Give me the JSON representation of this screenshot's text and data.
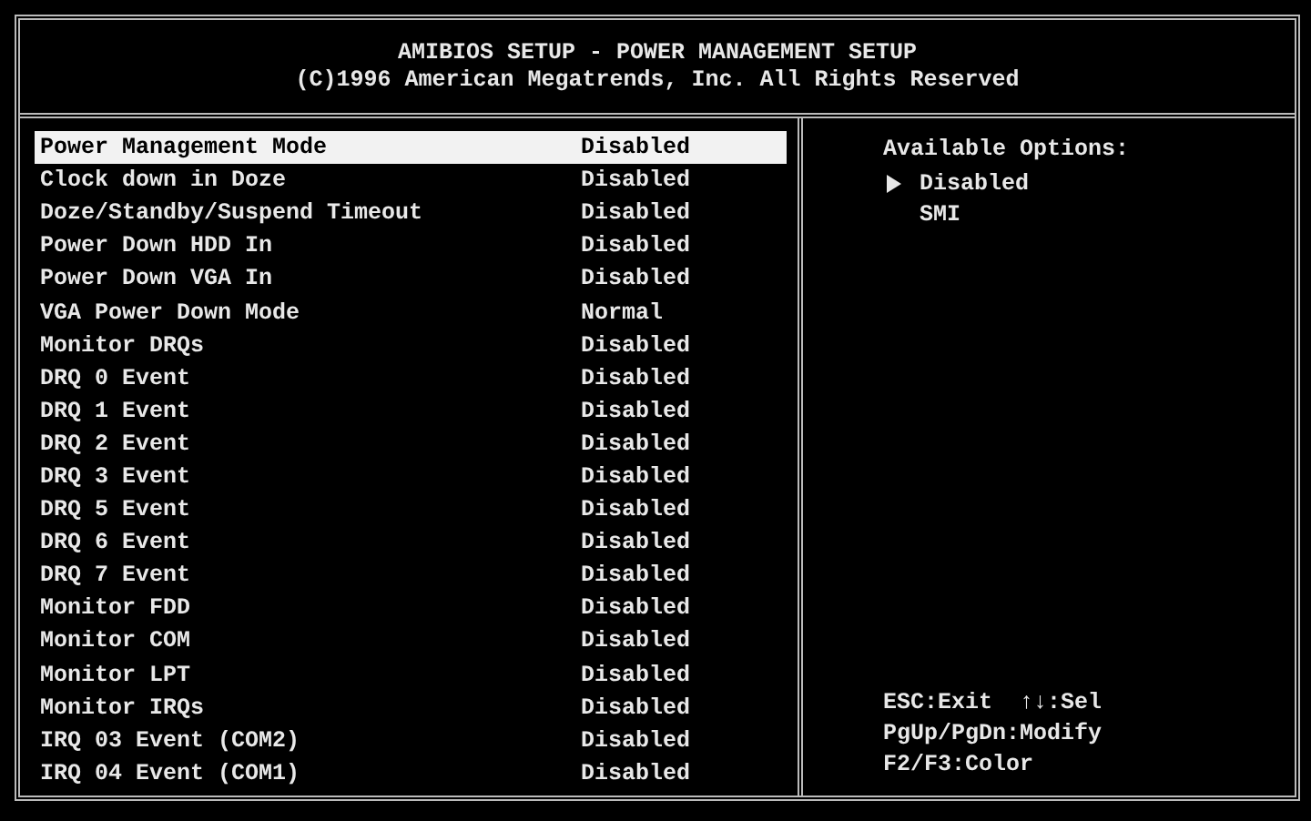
{
  "header": {
    "title": "AMIBIOS SETUP - POWER MANAGEMENT SETUP",
    "copyright": "(C)1996 American Megatrends, Inc. All Rights Reserved"
  },
  "settings": [
    {
      "label": "Power Management Mode",
      "value": "Disabled",
      "selected": true
    },
    {
      "label": "Clock down in Doze",
      "value": "Disabled",
      "selected": false
    },
    {
      "label": "Doze/Standby/Suspend Timeout",
      "value": "Disabled",
      "selected": false
    },
    {
      "label": "Power Down HDD In",
      "value": "Disabled",
      "selected": false
    },
    {
      "label": "Power Down VGA In",
      "value": "Disabled",
      "selected": false
    },
    {
      "label": "VGA Power Down Mode",
      "value": "Normal",
      "selected": false
    },
    {
      "label": "Monitor DRQs",
      "value": "Disabled",
      "selected": false
    },
    {
      "label": "DRQ 0 Event",
      "value": "Disabled",
      "selected": false
    },
    {
      "label": "DRQ 1 Event",
      "value": "Disabled",
      "selected": false
    },
    {
      "label": "DRQ 2 Event",
      "value": "Disabled",
      "selected": false
    },
    {
      "label": "DRQ 3 Event",
      "value": "Disabled",
      "selected": false
    },
    {
      "label": "DRQ 5 Event",
      "value": "Disabled",
      "selected": false
    },
    {
      "label": "DRQ 6 Event",
      "value": "Disabled",
      "selected": false
    },
    {
      "label": "DRQ 7 Event",
      "value": "Disabled",
      "selected": false
    },
    {
      "label": "Monitor FDD",
      "value": "Disabled",
      "selected": false
    },
    {
      "label": "Monitor COM",
      "value": "Disabled",
      "selected": false
    },
    {
      "label": "Monitor LPT",
      "value": "Disabled",
      "selected": false
    },
    {
      "label": "Monitor IRQs",
      "value": "Disabled",
      "selected": false
    },
    {
      "label": "IRQ 03 Event (COM2)",
      "value": "Disabled",
      "selected": false
    },
    {
      "label": "IRQ 04 Event (COM1)",
      "value": "Disabled",
      "selected": false
    }
  ],
  "options": {
    "title": "Available Options:",
    "items": [
      {
        "label": "Disabled",
        "selected": true
      },
      {
        "label": "SMI",
        "selected": false
      }
    ]
  },
  "help": [
    "ESC:Exit  ↑↓:Sel",
    "PgUp/PgDn:Modify",
    "F2/F3:Color"
  ]
}
